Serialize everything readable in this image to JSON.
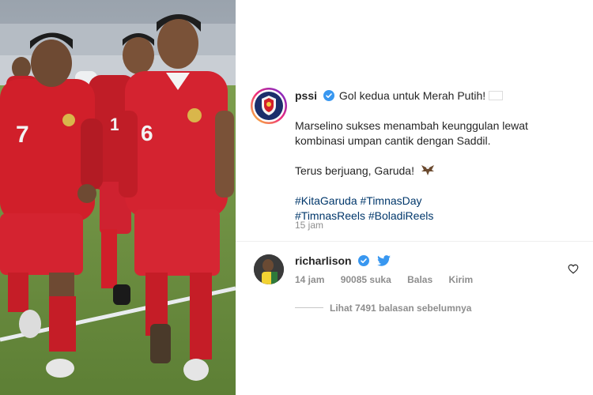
{
  "post": {
    "username": "pssi",
    "caption_line1": "Gol kedua untuk Merah Putih!",
    "caption_line2": "Marselino sukses menambah keunggulan lewat kombinasi umpan cantik dengan Saddil.",
    "caption_line3": "Terus berjuang, Garuda!",
    "hashtags_line1": "#KitaGaruda #TimnasDay",
    "hashtags_line2": "#TimnasReels #BoladiReels",
    "time": "15 jam"
  },
  "comment": {
    "username": "richarlison",
    "time": "14 jam",
    "likes": "90085 suka",
    "reply_label": "Balas",
    "send_label": "Kirim",
    "view_replies": "Lihat 7491 balasan sebelumnya"
  },
  "photo": {
    "jersey_numbers": [
      "7",
      "11",
      "6"
    ]
  },
  "colors": {
    "verified_blue": "#3897f0",
    "link_blue": "#00376b",
    "secondary_text": "#8e8e8e",
    "jersey_red": "#d11f2a"
  },
  "icons": [
    "verified-badge-icon",
    "indonesia-flag-icon",
    "eagle-icon",
    "twitter-bird-icon",
    "heart-icon"
  ]
}
